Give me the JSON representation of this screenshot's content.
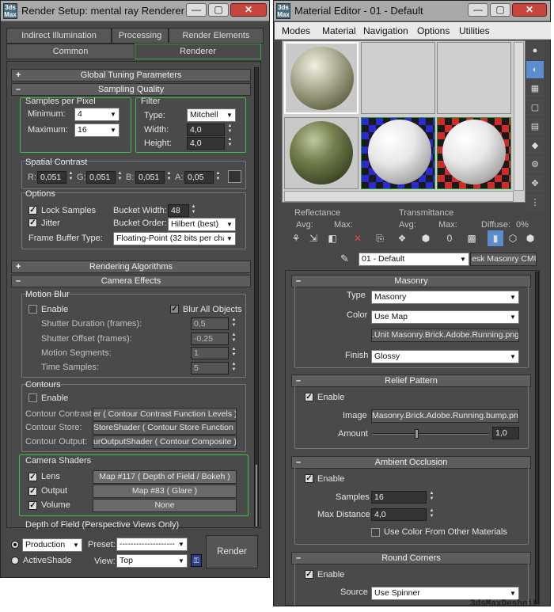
{
  "render_setup": {
    "title": "Render Setup: mental ray Renderer",
    "icon_text": "3ds Max",
    "tabs_row1": [
      "Indirect Illumination",
      "Processing",
      "Render Elements"
    ],
    "tabs_row2": [
      "Common",
      "Renderer"
    ],
    "active_tab": "Renderer",
    "rollouts": {
      "global_tuning": "Global Tuning Parameters",
      "sampling_quality": "Sampling Quality",
      "rendering_algorithms": "Rendering Algorithms",
      "camera_effects": "Camera Effects"
    },
    "samples_per_pixel": {
      "label": "Samples per Pixel",
      "min_label": "Minimum:",
      "min_value": "4",
      "max_label": "Maximum:",
      "max_value": "16"
    },
    "filter": {
      "label": "Filter",
      "type_label": "Type:",
      "type_value": "Mitchell",
      "width_label": "Width:",
      "width_value": "4,0",
      "height_label": "Height:",
      "height_value": "4,0"
    },
    "spatial_contrast": {
      "label": "Spatial Contrast",
      "r_label": "R:",
      "r_value": "0,051",
      "g_label": "G:",
      "g_value": "0,051",
      "b_label": "B:",
      "b_value": "0,051",
      "a_label": "A:",
      "a_value": "0,05"
    },
    "options": {
      "label": "Options",
      "lock_samples": "Lock Samples",
      "jitter": "Jitter",
      "bucket_width_label": "Bucket Width:",
      "bucket_width_value": "48",
      "bucket_order_label": "Bucket Order:",
      "bucket_order_value": "Hilbert (best)",
      "frame_buffer_label": "Frame Buffer Type:",
      "frame_buffer_value": "Floating-Point (32 bits per cha"
    },
    "motion_blur": {
      "label": "Motion Blur",
      "enable": "Enable",
      "blur_all": "Blur All Objects",
      "shutter_duration_label": "Shutter Duration (frames):",
      "shutter_duration_value": "0,5",
      "shutter_offset_label": "Shutter Offset (frames):",
      "shutter_offset_value": "-0,25",
      "motion_segments_label": "Motion Segments:",
      "motion_segments_value": "1",
      "time_samples_label": "Time Samples:",
      "time_samples_value": "5"
    },
    "contours": {
      "label": "Contours",
      "enable": "Enable",
      "contrast_label": "Contour Contrast:",
      "contrast_value": "er  ( Contour Contrast Function Levels )",
      "store_label": "Contour Store:",
      "store_value": "StoreShader  ( Contour Store Function )",
      "output_label": "Contour Output:",
      "output_value": "urOutputShader  ( Contour Composite )"
    },
    "camera_shaders": {
      "label": "Camera Shaders",
      "lens_label": "Lens",
      "lens_value": "Map #117  ( Depth of Field / Bokeh )",
      "output_label": "Output",
      "output_value": "Map #83  ( Glare )",
      "volume_label": "Volume",
      "volume_value": "None"
    },
    "dof_label": "Depth of Field (Perspective Views Only)",
    "footer": {
      "production": "Production",
      "activeshade": "ActiveShade",
      "preset_label": "Preset:",
      "preset_value": "--------------------",
      "view_label": "View:",
      "view_value": "Top",
      "render_button": "Render"
    }
  },
  "material_editor": {
    "title": "Material Editor - 01 - Default",
    "menu": [
      "Modes",
      "Material",
      "Navigation",
      "Options",
      "Utilities"
    ],
    "reflectance": {
      "title": "Reflectance",
      "avg": "Avg:",
      "max": "Max:"
    },
    "transmittance": {
      "title": "Transmittance",
      "avg": "Avg:",
      "max": "Max:",
      "diffuse": "Diffuse:",
      "diffuse_value": "0%"
    },
    "material_name": "01 - Default",
    "material_type": "esk Masonry CMU",
    "masonry": {
      "title": "Masonry",
      "type_label": "Type",
      "type_value": "Masonry",
      "color_label": "Color",
      "color_value": "Use Map",
      "map_value": ".Unit Masonry.Brick.Adobe.Running.png)",
      "finish_label": "Finish",
      "finish_value": "Glossy"
    },
    "relief": {
      "title": "Relief Pattern",
      "enable": "Enable",
      "image_label": "Image",
      "image_value": "Masonry.Brick.Adobe.Running.bump.png)",
      "amount_label": "Amount",
      "amount_value": "1,0",
      "amount_fraction": 0.38
    },
    "ambient_occlusion": {
      "title": "Ambient Occlusion",
      "enable": "Enable",
      "samples_label": "Samples",
      "samples_value": "16",
      "max_distance_label": "Max Distance",
      "max_distance_value": "4,0",
      "use_color_label": "Use Color From Other Materials"
    },
    "round_corners": {
      "title": "Round Corners",
      "enable": "Enable",
      "source_label": "Source",
      "source_value": "Use Spinner"
    }
  },
  "watermark": "3dsMaxDeshnik",
  "colors": {
    "panel_bg": "#474747",
    "title_bg": "#a9a9a9",
    "highlight_green": "#3fbf4a",
    "close_red": "#c6463e"
  }
}
